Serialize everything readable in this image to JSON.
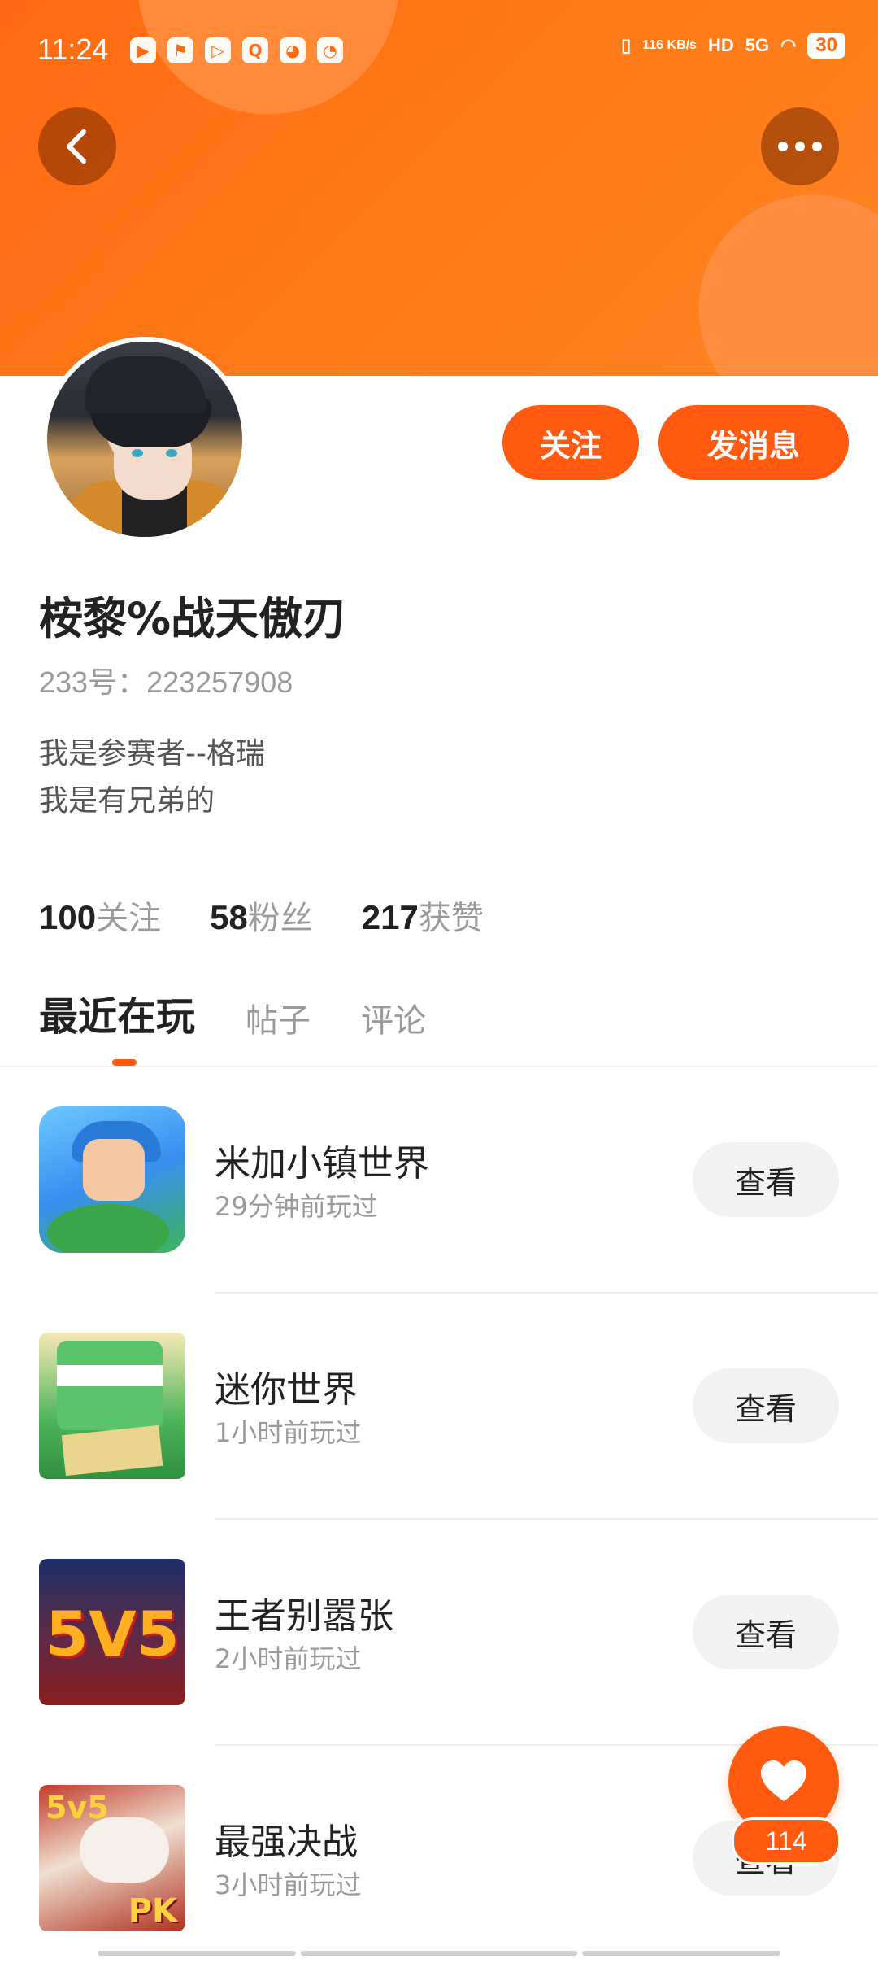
{
  "status_bar": {
    "time": "11:24",
    "network_speed": "116 KB/s",
    "hd": "HD",
    "network": "5G",
    "battery": "30",
    "app_icons": [
      "video-app-icon",
      "flag-app-icon",
      "play-app-icon",
      "search-app-icon",
      "cat-app-icon",
      "compass-app-icon"
    ]
  },
  "profile": {
    "username": "桉黎%战天傲刃",
    "id_line": "233号：223257908",
    "bio_lines": [
      "我是参赛者--格瑞",
      "我是有兄弟的"
    ],
    "follow_label": "关注",
    "message_label": "发消息"
  },
  "stats": {
    "following": {
      "value": "100",
      "label": "关注"
    },
    "fans": {
      "value": "58",
      "label": "粉丝"
    },
    "likes": {
      "value": "217",
      "label": "获赞"
    }
  },
  "tabs": [
    {
      "label": "最近在玩",
      "active": true
    },
    {
      "label": "帖子",
      "active": false
    },
    {
      "label": "评论",
      "active": false
    }
  ],
  "games": [
    {
      "name": "米加小镇世界",
      "time": "29分钟前玩过",
      "action": "查看"
    },
    {
      "name": "迷你世界",
      "time": "1小时前玩过",
      "action": "查看"
    },
    {
      "name": "王者别嚣张",
      "time": "2小时前玩过",
      "action": "查看",
      "icon_text": "5V5"
    },
    {
      "name": "最强决战",
      "time": "3小时前玩过",
      "action": "查看",
      "icon_text_top": "5v5",
      "icon_text_bottom": "PK"
    }
  ],
  "like_fab": {
    "count": "114"
  },
  "colors": {
    "accent": "#ff5a10",
    "header": "#ff7a18"
  }
}
